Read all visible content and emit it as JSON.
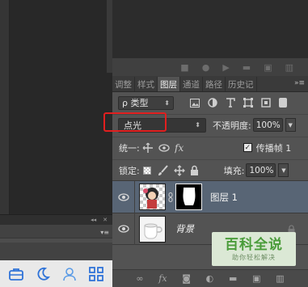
{
  "left": {
    "lower_header_icons": [
      "◂◂",
      "✕"
    ],
    "lower_menu_icon": "menu-icon",
    "toolbar_icons": [
      "briefcase-icon",
      "moon-icon",
      "user-icon",
      "grid-icon"
    ],
    "toolbar_color": "#2f73d8"
  },
  "panel": {
    "tabs": [
      "调整",
      "样式",
      "图层",
      "通道",
      "路径",
      "历史记"
    ],
    "active_tab": "图层",
    "tabs_menu": "»≡",
    "filter": {
      "label": "ρ 类型",
      "arrow": "⬍"
    },
    "blend_mode": {
      "value": "点光",
      "arrow": "⬍"
    },
    "opacity": {
      "label": "不透明度:",
      "value": "100%",
      "arrow": "▼"
    },
    "unify": {
      "label": "统一:"
    },
    "propagate": {
      "checked": true,
      "label": "传播帧 1"
    },
    "lock": {
      "label": "锁定:"
    },
    "fill": {
      "label": "填充:",
      "value": "100%",
      "arrow": "▼"
    },
    "layers": [
      {
        "name": "图层 1",
        "selected": true
      },
      {
        "name": "背景",
        "locked": true
      }
    ],
    "highlight_color": "#e21f1f"
  },
  "watermark": {
    "title": "百科全说",
    "subtitle": "助你轻松解决"
  }
}
